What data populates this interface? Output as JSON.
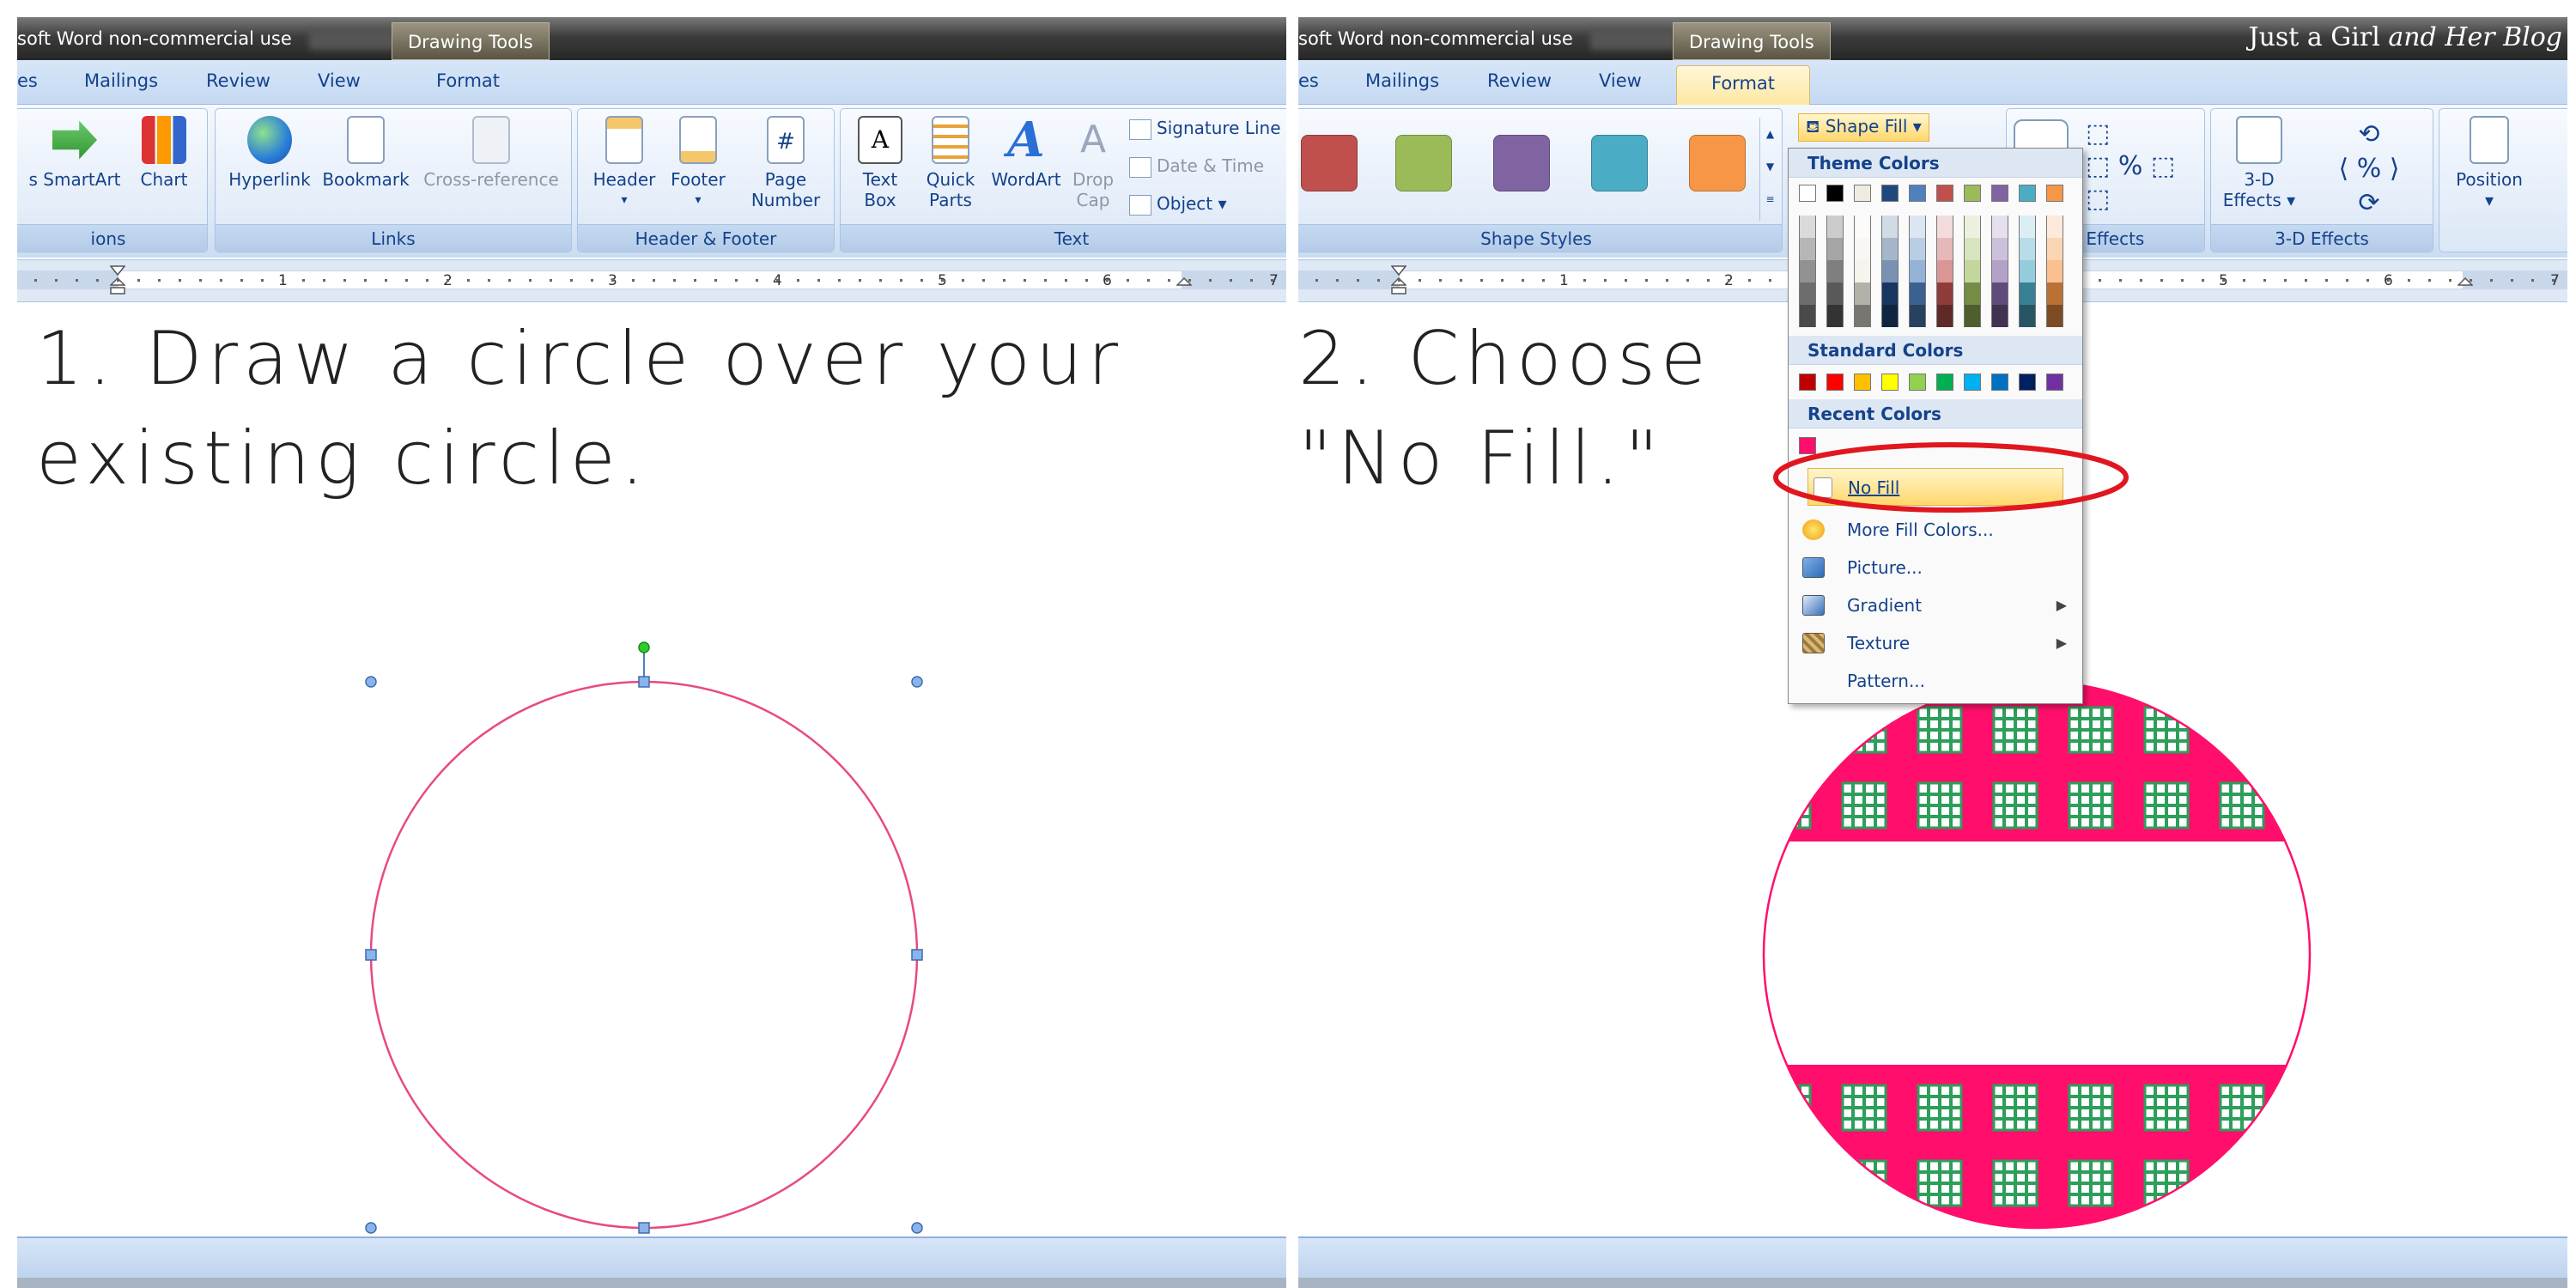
{
  "panels": [
    {
      "title_text": "soft Word non-commercial use",
      "drawing_tools": "Drawing Tools",
      "tabs": [
        "es",
        "Mailings",
        "Review",
        "View",
        "Format"
      ],
      "groups": [
        {
          "label": "ions"
        },
        {
          "label": "Links"
        },
        {
          "label": "Header & Footer"
        },
        {
          "label": "Text"
        }
      ],
      "buttons": {
        "smartart": "s SmartArt",
        "chart": "Chart",
        "hyperlink": "Hyperlink",
        "bookmark": "Bookmark",
        "crossref": "Cross-reference",
        "header": "Header",
        "footer": "Footer",
        "page_number_1": "Page",
        "page_number_2": "Number",
        "textbox_1": "Text",
        "textbox_2": "Box",
        "quickparts_1": "Quick",
        "quickparts_2": "Parts",
        "wordart": "WordArt",
        "dropcap_1": "Drop",
        "dropcap_2": "Cap",
        "signature": "Signature Line",
        "datetime": "Date & Time",
        "object": "Object"
      },
      "ruler_numbers": [
        "1",
        "2",
        "3",
        "4",
        "5",
        "6",
        "7"
      ],
      "instruction_line1": "1. Draw a circle over your",
      "instruction_line2": "existing circle.",
      "circle_color": "#e84a7f"
    },
    {
      "title_text": "soft Word non-commercial use",
      "drawing_tools": "Drawing Tools",
      "brand_plain": "Just a Girl ",
      "brand_italic": "and Her Blog",
      "tabs": [
        "es",
        "Mailings",
        "Review",
        "View",
        "Format"
      ],
      "groups": [
        {
          "label": "Shape Styles"
        },
        {
          "label": "w Effects"
        },
        {
          "label": "3-D Effects"
        }
      ],
      "shape_fill_label": "Shape Fill",
      "effects_1": "3-D",
      "effects_2": "Effects",
      "position_label": "Position",
      "swatch_colors": [
        "#c0504d",
        "#9bbb59",
        "#8064a2",
        "#4bacc6",
        "#f79646"
      ],
      "ruler_numbers": [
        "1",
        "2",
        "5",
        "6",
        "7"
      ],
      "instruction_line1": "2. Choose",
      "instruction_line2": "\"No Fill.\"",
      "dropdown": {
        "theme_header": "Theme Colors",
        "standard_header": "Standard Colors",
        "recent_header": "Recent Colors",
        "theme_top": [
          "#ffffff",
          "#000000",
          "#eeece1",
          "#1f497d",
          "#4f81bd",
          "#c0504d",
          "#9bbb59",
          "#8064a2",
          "#4bacc6",
          "#f79646"
        ],
        "standard": [
          "#c00000",
          "#ff0000",
          "#ffc000",
          "#ffff00",
          "#92d050",
          "#00b050",
          "#00b0f0",
          "#0070c0",
          "#002060",
          "#7030a0"
        ],
        "recent": [
          "#ff0f6b"
        ],
        "items": [
          "No Fill",
          "More Fill Colors...",
          "Picture...",
          "Gradient",
          "Texture",
          "Pattern..."
        ]
      },
      "pattern_color": "#ff0f6b",
      "pattern_grid_color": "#2e9e5b"
    }
  ]
}
